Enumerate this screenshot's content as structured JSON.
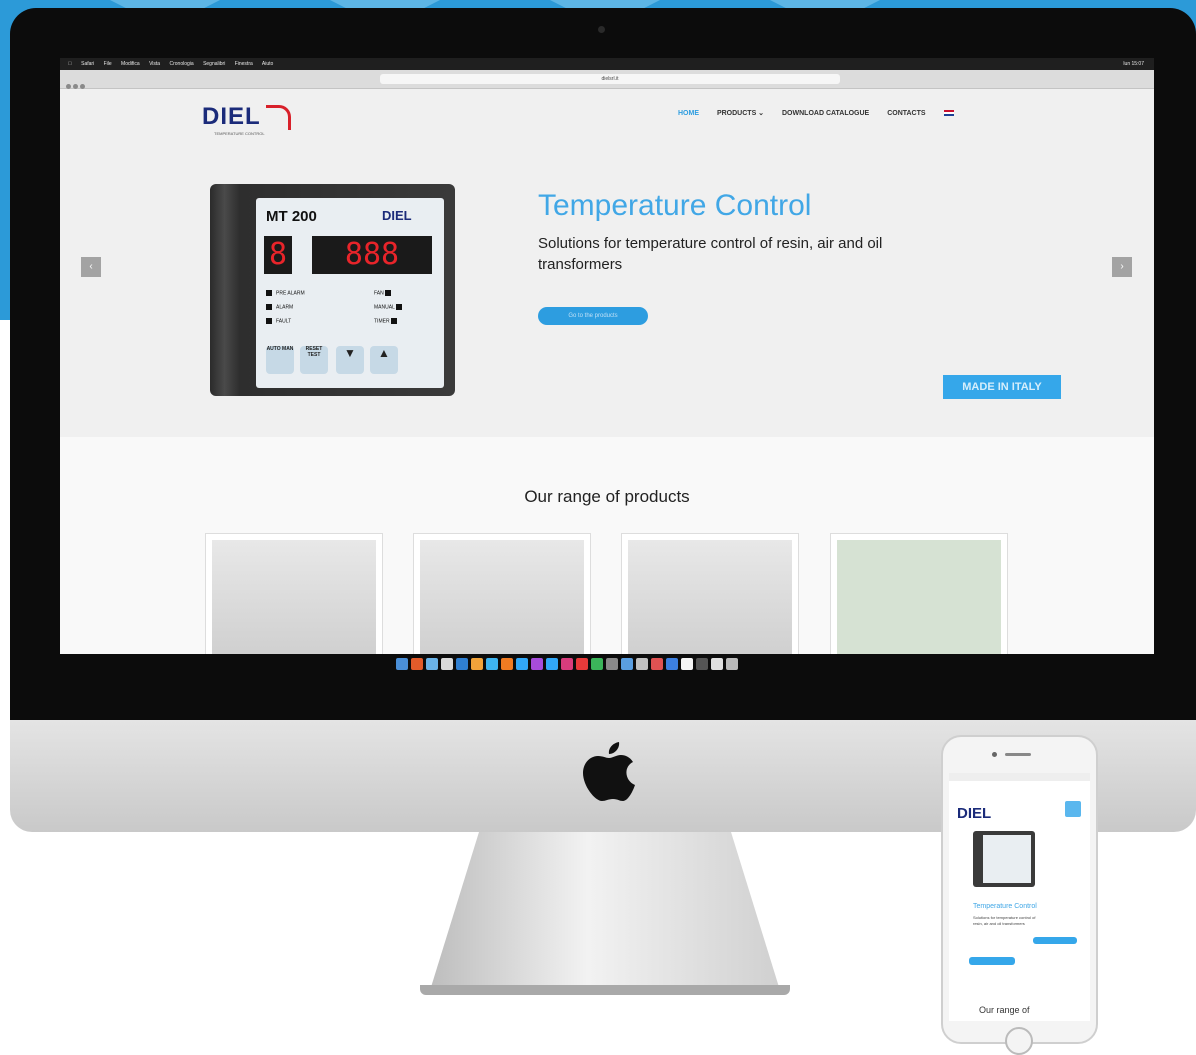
{
  "mac_menubar": {
    "items": [
      "Safari",
      "File",
      "Modifica",
      "Vista",
      "Cronologia",
      "Segnalibri",
      "Finestra",
      "Aiuto"
    ],
    "clock": "lun 15:07"
  },
  "browser": {
    "url": "dielsrl.it"
  },
  "site": {
    "logo_text": "DIEL",
    "logo_subtitle": "TEMPERATURE CONTROL",
    "nav": {
      "home": "HOME",
      "products": "PRODUCTS ⌄",
      "download": "DOWNLOAD CATALOGUE",
      "contacts": "CONTACTS"
    },
    "hero": {
      "title": "Temperature Control",
      "subtitle": "Solutions for temperature control of resin, air and oil transformers",
      "button": "Go to the products",
      "badge": "MADE IN ITALY"
    },
    "device": {
      "model": "MT 200",
      "brand": "DIEL",
      "digit1": "8",
      "digits": "888",
      "leds_left": [
        "PRE ALARM",
        "ALARM",
        "FAULT"
      ],
      "leds_right": [
        "FAN",
        "MANUAL",
        "TIMER"
      ],
      "buttons": [
        "AUTO MAN",
        "RESET TEST"
      ]
    },
    "range_title": "Our range of products"
  },
  "mobile": {
    "logo_text": "DIEL",
    "hero_title": "Temperature Control",
    "hero_text": "Solutions for temperature control of resin, air and oil transformers",
    "range_title": "Our range of"
  },
  "colors": {
    "accent": "#2d9de0",
    "brand_blue": "#1b2b7a",
    "brand_red": "#d8202a",
    "backdrop": "#2c9ad8"
  }
}
